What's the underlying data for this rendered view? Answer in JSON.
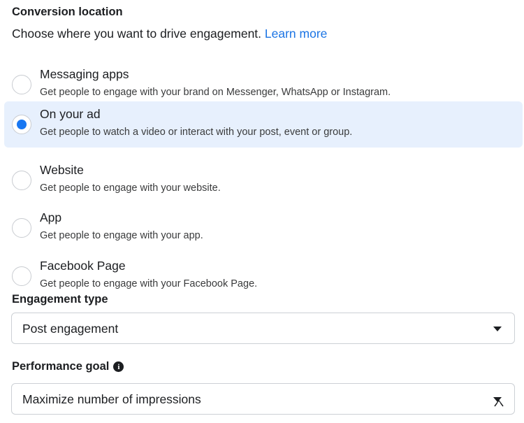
{
  "conversion_location": {
    "heading": "Conversion location",
    "subtitle": "Choose where you want to drive engagement.",
    "learn_more": "Learn more",
    "options": [
      {
        "title": "Messaging apps",
        "description": "Get people to engage with your brand on Messenger, WhatsApp or Instagram.",
        "selected": false
      },
      {
        "title": "On your ad",
        "description": "Get people to watch a video or interact with your post, event or group.",
        "selected": true
      },
      {
        "title": "Website",
        "description": "Get people to engage with your website.",
        "selected": false
      },
      {
        "title": "App",
        "description": "Get people to engage with your app.",
        "selected": false
      },
      {
        "title": "Facebook Page",
        "description": "Get people to engage with your Facebook Page.",
        "selected": false
      }
    ]
  },
  "engagement_type": {
    "heading": "Engagement type",
    "value": "Post engagement"
  },
  "performance_goal": {
    "heading": "Performance goal",
    "info_icon": "info-icon",
    "value": "Maximize number of impressions"
  },
  "colors": {
    "accent": "#1877f2",
    "link": "#1b74e4",
    "selected_bg": "#e7f0fd"
  }
}
